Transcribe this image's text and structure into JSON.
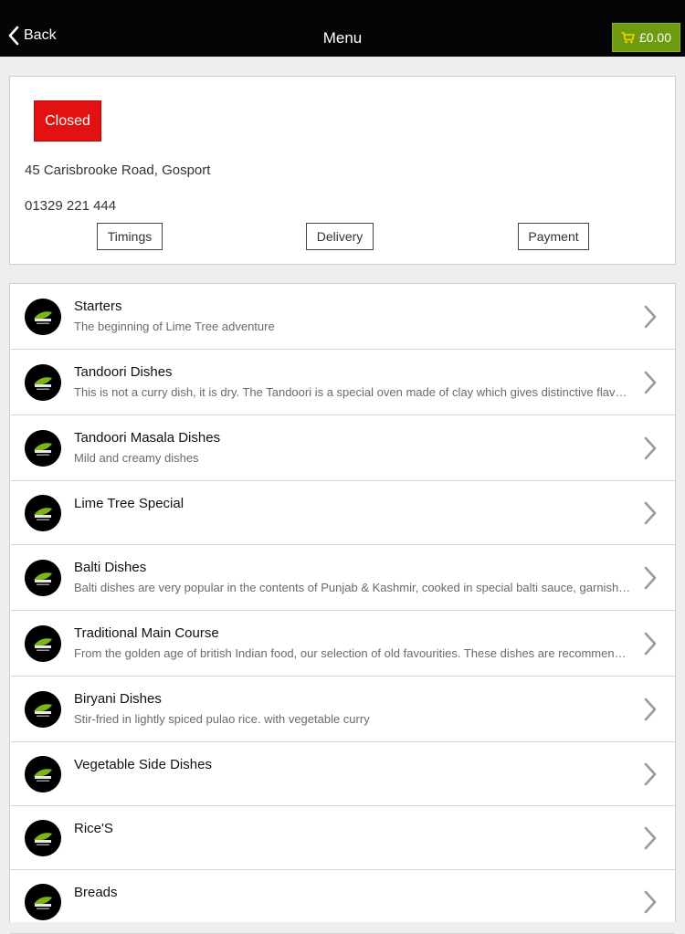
{
  "nav": {
    "back_label": "Back",
    "title": "Menu",
    "cart_total": "£0.00"
  },
  "info": {
    "status": "Closed",
    "address": "45 Carisbrooke Road, Gosport",
    "phone": "01329 221 444",
    "buttons": {
      "timings": "Timings",
      "delivery": "Delivery",
      "payment": "Payment"
    }
  },
  "colors": {
    "status_closed": "#e21212",
    "cart_bg": "#6f9b10",
    "nav_bg": "#050505",
    "logo_leaf": "#7cb518"
  },
  "icons": {
    "back": "chevron-left-icon",
    "cart": "cart-icon",
    "row_arrow": "chevron-right-icon",
    "row_logo": "lime-tree-logo-icon"
  },
  "categories": [
    {
      "title": "Starters",
      "desc": "The beginning of Lime Tree adventure"
    },
    {
      "title": "Tandoori Dishes",
      "desc": "This is not a curry dish, it is dry. The Tandoori is a special oven made of clay which gives distinctive flavour"
    },
    {
      "title": "Tandoori Masala Dishes",
      "desc": "Mild and creamy dishes"
    },
    {
      "title": "Lime Tree Special",
      "desc": ""
    },
    {
      "title": "Balti Dishes",
      "desc": "Balti dishes are very popular in the contents of Punjab & Kashmir, cooked in special balti sauce, garnished"
    },
    {
      "title": "Traditional Main Course",
      "desc": "From the golden age of british Indian food, our selection of old favourities. These dishes are recommended"
    },
    {
      "title": "Biryani Dishes",
      "desc": "Stir-fried in lightly spiced pulao rice. with vegetable curry"
    },
    {
      "title": "Vegetable Side Dishes",
      "desc": ""
    },
    {
      "title": "Rice'S",
      "desc": ""
    },
    {
      "title": "Breads",
      "desc": ""
    }
  ]
}
